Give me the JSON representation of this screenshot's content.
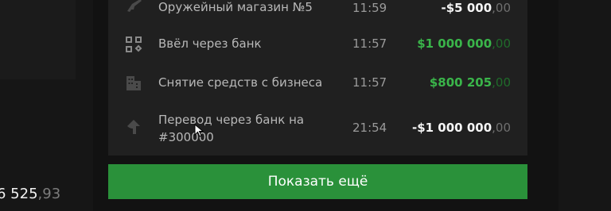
{
  "left": {
    "balance_main": "6 525",
    "balance_cents": ",93"
  },
  "transactions": [
    {
      "icon": "gun-icon",
      "name": "Оружейный магазин №5",
      "time": "11:59",
      "amount_main": "-$5 000",
      "amount_cents": ",00",
      "type": "negative"
    },
    {
      "icon": "qr-code-icon",
      "name": "Ввёл через банк",
      "time": "11:57",
      "amount_main": "$1 000 000",
      "amount_cents": ",00",
      "type": "positive"
    },
    {
      "icon": "building-icon",
      "name": "Снятие средств с бизнеса",
      "time": "11:57",
      "amount_main": "$800 205",
      "amount_cents": ",00",
      "type": "positive"
    },
    {
      "icon": "transfer-arrow-icon",
      "name": "Перевод через банк на #300000",
      "time": "21:54",
      "amount_main": "-$1 000 000",
      "amount_cents": ",00",
      "type": "negative"
    }
  ],
  "show_more_label": "Показать ещё",
  "colors": {
    "accent": "#2a913a",
    "positive": "#3ab54a",
    "card": "#202020",
    "background": "#121212"
  }
}
